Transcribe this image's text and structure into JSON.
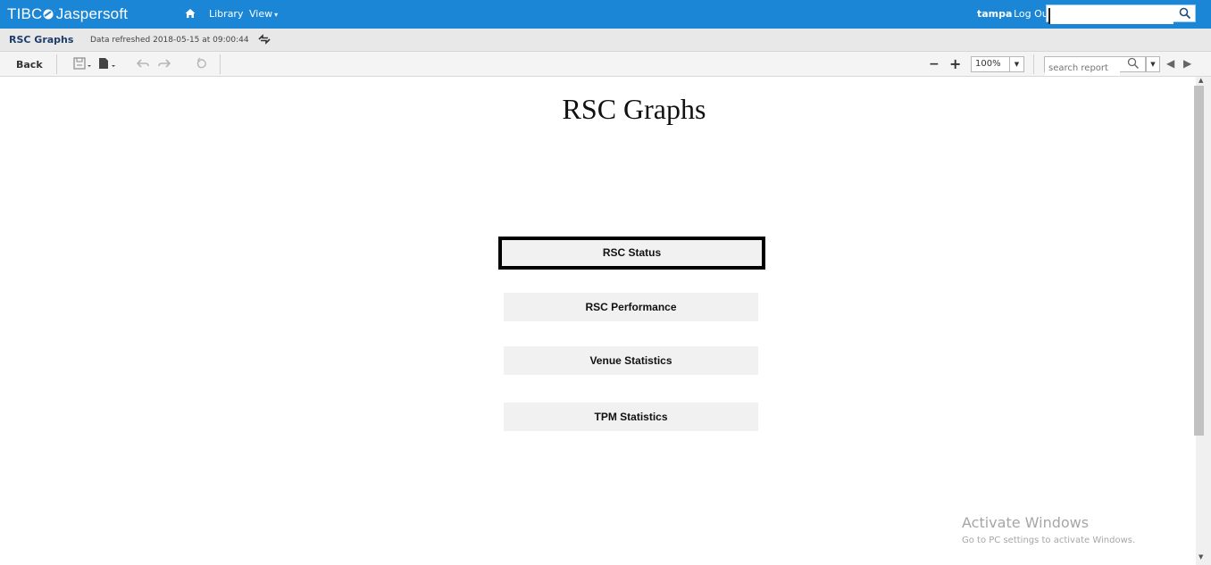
{
  "app": {
    "logo_text": "TIBCO Jaspersoft",
    "logo_part1": "TIBC",
    "logo_part2": "Jaspersoft",
    "brand_color": "#1b86d6"
  },
  "nav": {
    "home_icon": "home-icon",
    "library_label": "Library",
    "view_label": "View",
    "user": "tampa",
    "logout_label": "Log Out",
    "search_value": "",
    "search_icon": "search-icon"
  },
  "titlebar": {
    "report_title": "RSC Graphs",
    "refresh_text": "Data refreshed 2018-05-15 at 09:00:44",
    "refresh_icon": "refresh-icon"
  },
  "toolbar": {
    "back_label": "Back",
    "save_icon": "save-icon",
    "export_icon": "export-icon",
    "undo_icon": "undo-icon",
    "redo_icon": "redo-icon",
    "undo_all_icon": "undo-all-icon",
    "zoom_out_label": "−",
    "zoom_in_label": "+",
    "zoom_value": "100%",
    "search_placeholder": "search report",
    "prev_label": "◀",
    "next_label": "▶"
  },
  "report": {
    "heading": "RSC Graphs",
    "buttons": [
      "RSC Status",
      "RSC Performance",
      "Venue Statistics",
      "TPM Statistics"
    ]
  },
  "watermark": {
    "line1": "Activate Windows",
    "line2": "Go to PC settings to activate Windows."
  }
}
